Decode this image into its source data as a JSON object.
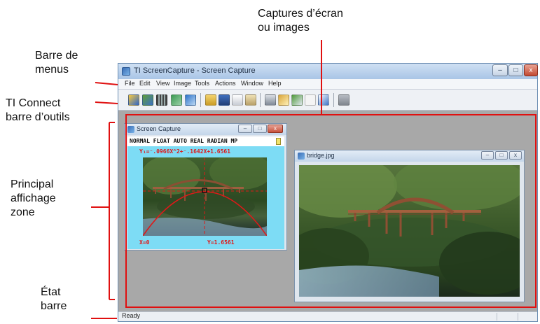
{
  "callouts": {
    "menus": [
      "Barre de",
      "menus"
    ],
    "toolbar": [
      "TI Connect",
      "barre d’outils"
    ],
    "main_area": [
      "Principal",
      "affichage",
      "zone"
    ],
    "status": [
      "État",
      "barre"
    ],
    "captures": [
      "Captures d’écran",
      "ou images"
    ]
  },
  "window": {
    "title": "TI ScreenCapture - Screen Capture",
    "min_label": "–",
    "max_label": "□",
    "close_label": "x"
  },
  "menu": [
    "File",
    "Edit",
    "View",
    "Image",
    "Tools",
    "Actions",
    "Window",
    "Help"
  ],
  "toolbar_icons": [
    "get-screen-icon",
    "send-screen-icon",
    "multi-screen-icon",
    "refresh-screen-icon",
    "camera-icon",
    "open-icon",
    "save-icon",
    "copy-icon",
    "paste-icon",
    "print-icon",
    "export-icon",
    "zoom-icon",
    "grid-icon",
    "edit-border-icon",
    "stamp-icon"
  ],
  "screen_capture": {
    "title": "Screen Capture",
    "status_line": "NORMAL FLOAT AUTO REAL RADIAN MP",
    "equation": "Y₁=⁻.0966X^2+⁻.1642X+1.6561",
    "x_readout": "X=0",
    "y_readout": "Y=1.6561"
  },
  "bridge": {
    "title": "bridge.jpg"
  },
  "statusbar": {
    "text": "Ready"
  },
  "colors": {
    "highlight": "#e01010",
    "calc_bg": "#7ddcf5",
    "calc_text": "#e01818"
  }
}
